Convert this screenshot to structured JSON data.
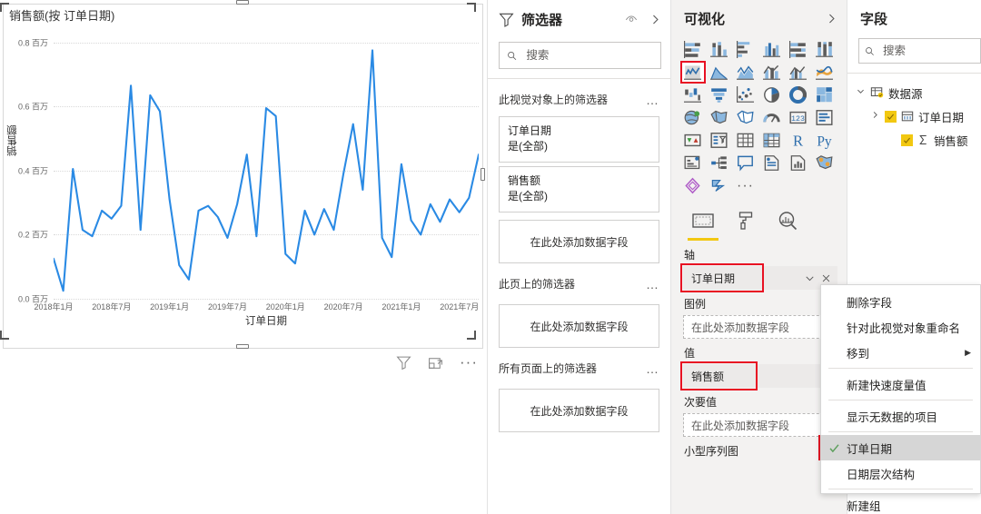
{
  "chart_data": {
    "type": "line",
    "title": "销售额(按 订单日期)",
    "xlabel": "订单日期",
    "ylabel": "销售额",
    "ylim": [
      0,
      0.85
    ],
    "grid": true,
    "legend": "none",
    "line_color": "#2a8ae4",
    "y_ticks": [
      "0.0 百万",
      "0.2 百万",
      "0.4 百万",
      "0.6 百万",
      "0.8 百万"
    ],
    "y_tick_values": [
      0.0,
      0.2,
      0.4,
      0.6,
      0.8
    ],
    "x_ticks": [
      "2018年1月",
      "2018年7月",
      "2019年1月",
      "2019年7月",
      "2020年1月",
      "2020年7月",
      "2021年1月",
      "2021年7月"
    ],
    "x": [
      "2018-01",
      "2018-02",
      "2018-03",
      "2018-04",
      "2018-05",
      "2018-06",
      "2018-07",
      "2018-08",
      "2018-09",
      "2018-10",
      "2018-11",
      "2018-12",
      "2019-01",
      "2019-02",
      "2019-03",
      "2019-04",
      "2019-05",
      "2019-06",
      "2019-07",
      "2019-08",
      "2019-09",
      "2019-10",
      "2019-11",
      "2019-12",
      "2020-01",
      "2020-02",
      "2020-03",
      "2020-04",
      "2020-05",
      "2020-06",
      "2020-07",
      "2020-08",
      "2020-09",
      "2020-10",
      "2020-11",
      "2020-12",
      "2021-01",
      "2021-02",
      "2021-03",
      "2021-04",
      "2021-05",
      "2021-06",
      "2021-07",
      "2021-08",
      "2021-09"
    ],
    "values": [
      0.125,
      0.025,
      0.405,
      0.215,
      0.195,
      0.275,
      0.25,
      0.29,
      0.665,
      0.215,
      0.635,
      0.585,
      0.31,
      0.105,
      0.06,
      0.275,
      0.29,
      0.255,
      0.19,
      0.295,
      0.45,
      0.195,
      0.595,
      0.57,
      0.14,
      0.11,
      0.275,
      0.2,
      0.28,
      0.215,
      0.39,
      0.545,
      0.34,
      0.775,
      0.19,
      0.13,
      0.42,
      0.245,
      0.2,
      0.295,
      0.24,
      0.31,
      0.27,
      0.315,
      0.45
    ],
    "footer_icons": [
      "filter-icon",
      "focus-mode-icon",
      "more-options-icon"
    ]
  },
  "filters_pane": {
    "title": "筛选器",
    "icon": "filter-icon",
    "hide_icon": "eye-hide-icon",
    "collapse_icon": "chevron-right-icon",
    "search": {
      "placeholder": "搜索",
      "value": "",
      "icon": "search-icon"
    },
    "sections": [
      {
        "title": "此视觉对象上的筛选器",
        "menu": "…",
        "cards": [
          {
            "name": "订单日期",
            "value": "是(全部)"
          },
          {
            "name": "销售额",
            "value": "是(全部)"
          }
        ],
        "dropzone": "在此处添加数据字段"
      },
      {
        "title": "此页上的筛选器",
        "menu": "…",
        "cards": [],
        "dropzone": "在此处添加数据字段"
      },
      {
        "title": "所有页面上的筛选器",
        "menu": "…",
        "cards": [],
        "dropzone": "在此处添加数据字段"
      }
    ]
  },
  "viz_pane": {
    "title": "可视化",
    "collapse_icon": "chevron-right-icon",
    "icons": [
      {
        "name": "stacked-bar-chart-icon",
        "selected": false
      },
      {
        "name": "stacked-column-chart-icon",
        "selected": false
      },
      {
        "name": "clustered-bar-chart-icon",
        "selected": false
      },
      {
        "name": "clustered-column-chart-icon",
        "selected": false
      },
      {
        "name": "100-stacked-bar-chart-icon",
        "selected": false
      },
      {
        "name": "100-stacked-column-chart-icon",
        "selected": false
      },
      {
        "name": "line-chart-icon",
        "selected": true
      },
      {
        "name": "area-chart-icon",
        "selected": false
      },
      {
        "name": "stacked-area-chart-icon",
        "selected": false
      },
      {
        "name": "line-and-stacked-column-chart-icon",
        "selected": false
      },
      {
        "name": "line-and-clustered-column-chart-icon",
        "selected": false
      },
      {
        "name": "ribbon-chart-icon",
        "selected": false
      },
      {
        "name": "waterfall-chart-icon",
        "selected": false
      },
      {
        "name": "funnel-chart-icon",
        "selected": false
      },
      {
        "name": "scatter-chart-icon",
        "selected": false
      },
      {
        "name": "pie-chart-icon",
        "selected": false
      },
      {
        "name": "donut-chart-icon",
        "selected": false
      },
      {
        "name": "treemap-icon",
        "selected": false
      },
      {
        "name": "map-icon",
        "selected": false
      },
      {
        "name": "filled-map-icon",
        "selected": false
      },
      {
        "name": "shape-map-icon",
        "selected": false
      },
      {
        "name": "gauge-icon",
        "selected": false
      },
      {
        "name": "card-icon",
        "selected": false
      },
      {
        "name": "multi-row-card-icon",
        "selected": false
      },
      {
        "name": "kpi-icon",
        "selected": false
      },
      {
        "name": "slicer-icon",
        "selected": false
      },
      {
        "name": "table-icon",
        "selected": false
      },
      {
        "name": "matrix-icon",
        "selected": false
      },
      {
        "name": "r-script-visual-icon",
        "selected": false
      },
      {
        "name": "python-visual-icon",
        "selected": false
      },
      {
        "name": "key-influencers-icon",
        "selected": false
      },
      {
        "name": "decomposition-tree-icon",
        "selected": false
      },
      {
        "name": "qna-icon",
        "selected": false
      },
      {
        "name": "smart-narrative-icon",
        "selected": false
      },
      {
        "name": "paginated-report-icon",
        "selected": false
      },
      {
        "name": "arcgis-map-icon",
        "selected": false
      },
      {
        "name": "power-apps-icon",
        "selected": false
      },
      {
        "name": "power-automate-icon",
        "selected": false
      },
      {
        "name": "more-visuals-icon",
        "selected": false
      }
    ],
    "tabs": [
      {
        "name": "fields-tab",
        "icon": "fields-pane-icon",
        "active": true
      },
      {
        "name": "format-tab",
        "icon": "paint-roller-icon",
        "active": false
      },
      {
        "name": "analytics-tab",
        "icon": "magnifier-chart-icon",
        "active": false
      }
    ],
    "buckets": [
      {
        "label": "轴",
        "value": "订单日期",
        "filled": true,
        "highlighted": true,
        "actions": [
          "chevron-down-icon",
          "close-icon"
        ]
      },
      {
        "label": "图例",
        "value": "在此处添加数据字段",
        "filled": false,
        "highlighted": false,
        "actions": []
      },
      {
        "label": "值",
        "value": "销售额",
        "filled": true,
        "highlighted": true,
        "actions": []
      },
      {
        "label": "次要值",
        "value": "在此处添加数据字段",
        "filled": false,
        "highlighted": false,
        "actions": []
      },
      {
        "label": "小型序列图",
        "value": "",
        "filled": false,
        "highlighted": false,
        "actions": []
      }
    ]
  },
  "context_menu": {
    "items": [
      {
        "label": "删除字段",
        "checked": false,
        "submenu": false,
        "highlighted": false,
        "sep_after": false
      },
      {
        "label": "针对此视觉对象重命名",
        "checked": false,
        "submenu": false,
        "highlighted": false,
        "sep_after": false
      },
      {
        "label": "移到",
        "checked": false,
        "submenu": true,
        "highlighted": false,
        "sep_after": true
      },
      {
        "label": "新建快速度量值",
        "checked": false,
        "submenu": false,
        "highlighted": false,
        "sep_after": true
      },
      {
        "label": "显示无数据的项目",
        "checked": false,
        "submenu": false,
        "highlighted": false,
        "sep_after": true
      },
      {
        "label": "订单日期",
        "checked": true,
        "submenu": false,
        "highlighted": true,
        "sep_after": false
      },
      {
        "label": "日期层次结构",
        "checked": false,
        "submenu": false,
        "highlighted": false,
        "sep_after": true
      },
      {
        "label": "新建组",
        "checked": false,
        "submenu": false,
        "highlighted": false,
        "sep_after": false
      }
    ]
  },
  "fields_pane": {
    "title": "字段",
    "search": {
      "placeholder": "搜索",
      "value": "",
      "icon": "search-icon"
    },
    "tree": [
      {
        "level": 0,
        "label": "数据源",
        "chevron": "chevron-down-icon",
        "icon": "table-badge-icon",
        "checked": false,
        "has_checkbox": false
      },
      {
        "level": 1,
        "label": "订单日期",
        "chevron": "chevron-right-icon",
        "icon": "calendar-icon",
        "checked": true,
        "has_checkbox": true
      },
      {
        "level": 2,
        "label": "销售额",
        "chevron": "",
        "icon": "sigma-icon",
        "checked": true,
        "has_checkbox": true
      }
    ]
  },
  "colors": {
    "accent": "#f2c811",
    "line": "#2a8ae4",
    "highlight_red": "#e81123",
    "pane_bg": "#f3f2f1",
    "check_green": "#5a9e5a"
  }
}
